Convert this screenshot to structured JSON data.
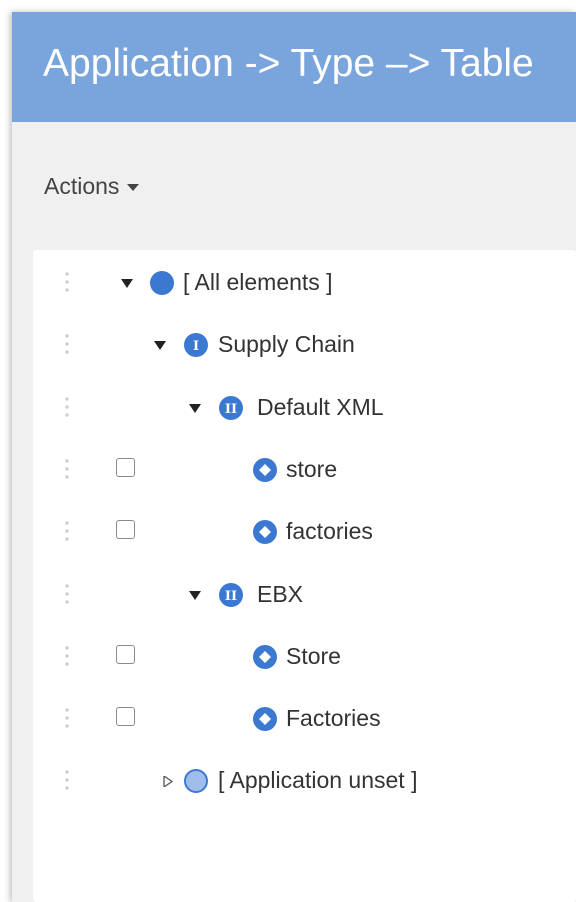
{
  "header": {
    "title": "Application -> Type –> Table"
  },
  "toolbar": {
    "actions_label": "Actions"
  },
  "tree": [
    {
      "label": "[ All elements ]",
      "level": 0,
      "expanded": true,
      "icon": "filled-circle-icon",
      "checkbox": false
    },
    {
      "label": "Supply Chain",
      "level": 1,
      "expanded": true,
      "icon": "roman-one-icon",
      "icon_text": "I",
      "checkbox": false
    },
    {
      "label": "Default XML",
      "level": 2,
      "expanded": true,
      "icon": "roman-two-icon",
      "icon_text": "II",
      "checkbox": false
    },
    {
      "label": "store",
      "level": 3,
      "icon": "diamond-icon",
      "checkbox": true
    },
    {
      "label": "factories",
      "level": 3,
      "icon": "diamond-icon",
      "checkbox": true
    },
    {
      "label": "EBX",
      "level": 2,
      "expanded": true,
      "icon": "roman-two-icon",
      "icon_text": "II",
      "checkbox": false
    },
    {
      "label": "Store",
      "level": 3,
      "icon": "diamond-icon",
      "checkbox": true
    },
    {
      "label": "Factories",
      "level": 3,
      "icon": "diamond-icon",
      "checkbox": true
    },
    {
      "label": "[ Application unset ]",
      "level": 1,
      "expanded": false,
      "icon": "light-circle-icon",
      "checkbox": false
    }
  ],
  "colors": {
    "header_bg": "#7aa5dc",
    "accent": "#3a78d1",
    "light_node": "#9fbde8",
    "background": "#f0f0f0"
  }
}
